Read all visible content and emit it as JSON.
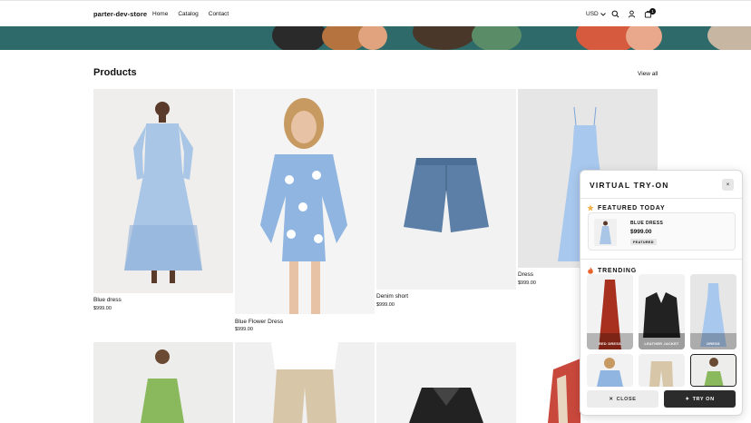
{
  "header": {
    "brand": "parter-dev-store",
    "nav": [
      "Home",
      "Catalog",
      "Contact"
    ],
    "currency": "USD",
    "cart_count": "1",
    "icons": [
      "search-icon",
      "account-icon",
      "cart-icon"
    ]
  },
  "products": {
    "title": "Products",
    "view_all": "View all",
    "items": [
      {
        "name": "Blue dress",
        "price": "$999.00"
      },
      {
        "name": "Blue Flower Dress",
        "price": "$999.00"
      },
      {
        "name": "Denim short",
        "price": "$999.00"
      },
      {
        "name": "Dress",
        "price": "$999.00"
      }
    ]
  },
  "tryon": {
    "title": "VIRTUAL TRY-ON",
    "close_x": "×",
    "featured": {
      "title": "FEATURED TODAY",
      "name": "BLUE DRESS",
      "price": "$999.00",
      "badge": "FEATURED"
    },
    "trending": {
      "title": "TRENDING",
      "items": [
        "RED DRESS",
        "LEATHER JACKET",
        "DRESS"
      ]
    },
    "close_label": "CLOSE",
    "try_label": "TRY ON"
  },
  "colors": {
    "accent_dark": "#2b2b2b",
    "banner": "#2e6a6a"
  }
}
